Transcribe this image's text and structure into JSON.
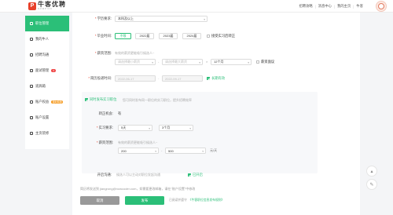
{
  "header": {
    "logo_mark": "P",
    "logo_title": "牛客优聘",
    "logo_sub": "NOWPICK",
    "links": [
      "招聘攻略",
      "消息中心",
      "我的主页",
      "牛客"
    ],
    "avatar_icon": "user-avatar-icon"
  },
  "sidebar": {
    "items": [
      {
        "label": "职位管理",
        "icon": "briefcase-icon",
        "active": true
      },
      {
        "label": "我的牛人",
        "icon": "person-icon"
      },
      {
        "label": "招聘沟通",
        "icon": "chat-icon"
      },
      {
        "label": "面试管理",
        "icon": "calendar-icon",
        "badge": "3"
      },
      {
        "label": "道具箱",
        "icon": "toolbox-icon"
      },
      {
        "label": "账户权益",
        "icon": "gift-icon",
        "badge": "限时特惠"
      },
      {
        "label": "账户设置",
        "icon": "settings-icon"
      },
      {
        "label": "主页装修",
        "icon": "palette-icon"
      }
    ]
  },
  "form": {
    "education": {
      "label": "学历要求:",
      "value": "本科及以上"
    },
    "graduation": {
      "label": "毕业时间:",
      "options": [
        "不限",
        "2022届",
        "2023届",
        "2024届"
      ],
      "selected": "不限",
      "extra_checkbox": "接受实习后转正"
    },
    "salary": {
      "label": "薪资范围:",
      "hint": "有效的薪资更能吸引候选人~",
      "min_placeholder": "请选择最小薪资",
      "max_placeholder": "请选择最大薪资",
      "months": "12个月",
      "negotiable": "薪资面议"
    },
    "deadline": {
      "label": "简历投递时间:",
      "start": "2022-06-17",
      "end": "2022-09-17",
      "long_term": "长期有效"
    },
    "intern": {
      "toggle_label": "同时发布实习职位",
      "toggle_desc": "您可同时发布同一职位的实习职位，提升招聘效率",
      "convert_label": "转正机会:",
      "convert_value": "有",
      "duration_label": "实习要求:",
      "days": "5天",
      "months": "3个月",
      "salary_label": "薪资范围:",
      "salary_hint": "有效的薪资更能吸引候选人~",
      "salary_min": "200",
      "salary_max": "500",
      "salary_unit": "元/天"
    },
    "chat": {
      "label": "开启沟通:",
      "desc": "候选人可以主动对职位发起沟通",
      "toggle": "已开启"
    },
    "email_note": "简历将发送到 jiangrong@nowcoder.com，如需要更改邮箱，请在\"账户设置\"中修改",
    "cancel_label": "取消",
    "publish_label": "发布",
    "agree_prefix": "已阅读并遵守",
    "agree_link": "《牛客职位信息发布规则》"
  },
  "colors": {
    "accent": "#2bbf78",
    "brand": "#e8402a"
  }
}
